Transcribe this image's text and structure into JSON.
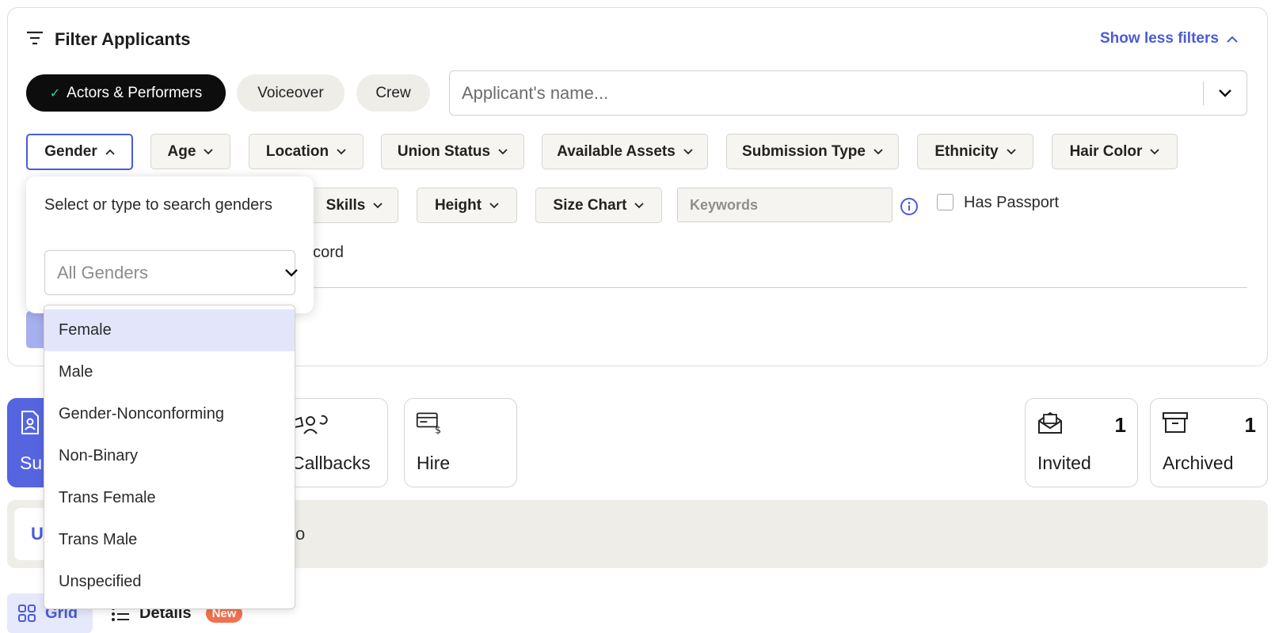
{
  "header": {
    "title": "Filter Applicants",
    "show_less": "Show less filters"
  },
  "categories": [
    {
      "label": "Actors & Performers",
      "active": true
    },
    {
      "label": "Voiceover",
      "active": false
    },
    {
      "label": "Crew",
      "active": false
    }
  ],
  "name_search": {
    "placeholder": "Applicant's name..."
  },
  "filters_row1": [
    "Gender",
    "Age",
    "Location",
    "Union Status",
    "Available Assets",
    "Submission Type",
    "Ethnicity",
    "Hair Color"
  ],
  "filters_row2": [
    "Skills",
    "Height",
    "Size Chart"
  ],
  "keywords": {
    "placeholder": "Keywords"
  },
  "passport": {
    "label": "Has Passport"
  },
  "behind": {
    "record_fragment": "ecord"
  },
  "gender_popover": {
    "prompt": "Select or type to search genders",
    "placeholder": "All Genders",
    "options": [
      "Female",
      "Male",
      "Gender-Nonconforming",
      "Non-Binary",
      "Trans Female",
      "Trans Male",
      "Unspecified"
    ],
    "highlighted": "Female"
  },
  "stages": {
    "submissions": "Su",
    "callbacks": "Callbacks",
    "hire": "Hire",
    "invited": {
      "label": "Invited",
      "count": "1"
    },
    "archived": {
      "label": "Archived",
      "count": "1"
    }
  },
  "info_bar": {
    "left": "U",
    "right": "o"
  },
  "view": {
    "grid": "Grid",
    "details": "Details",
    "new_badge": "New"
  },
  "colors": {
    "accent": "#4a5bd8",
    "active_pill": "#0d0d0d",
    "badge": "#f2704e"
  }
}
